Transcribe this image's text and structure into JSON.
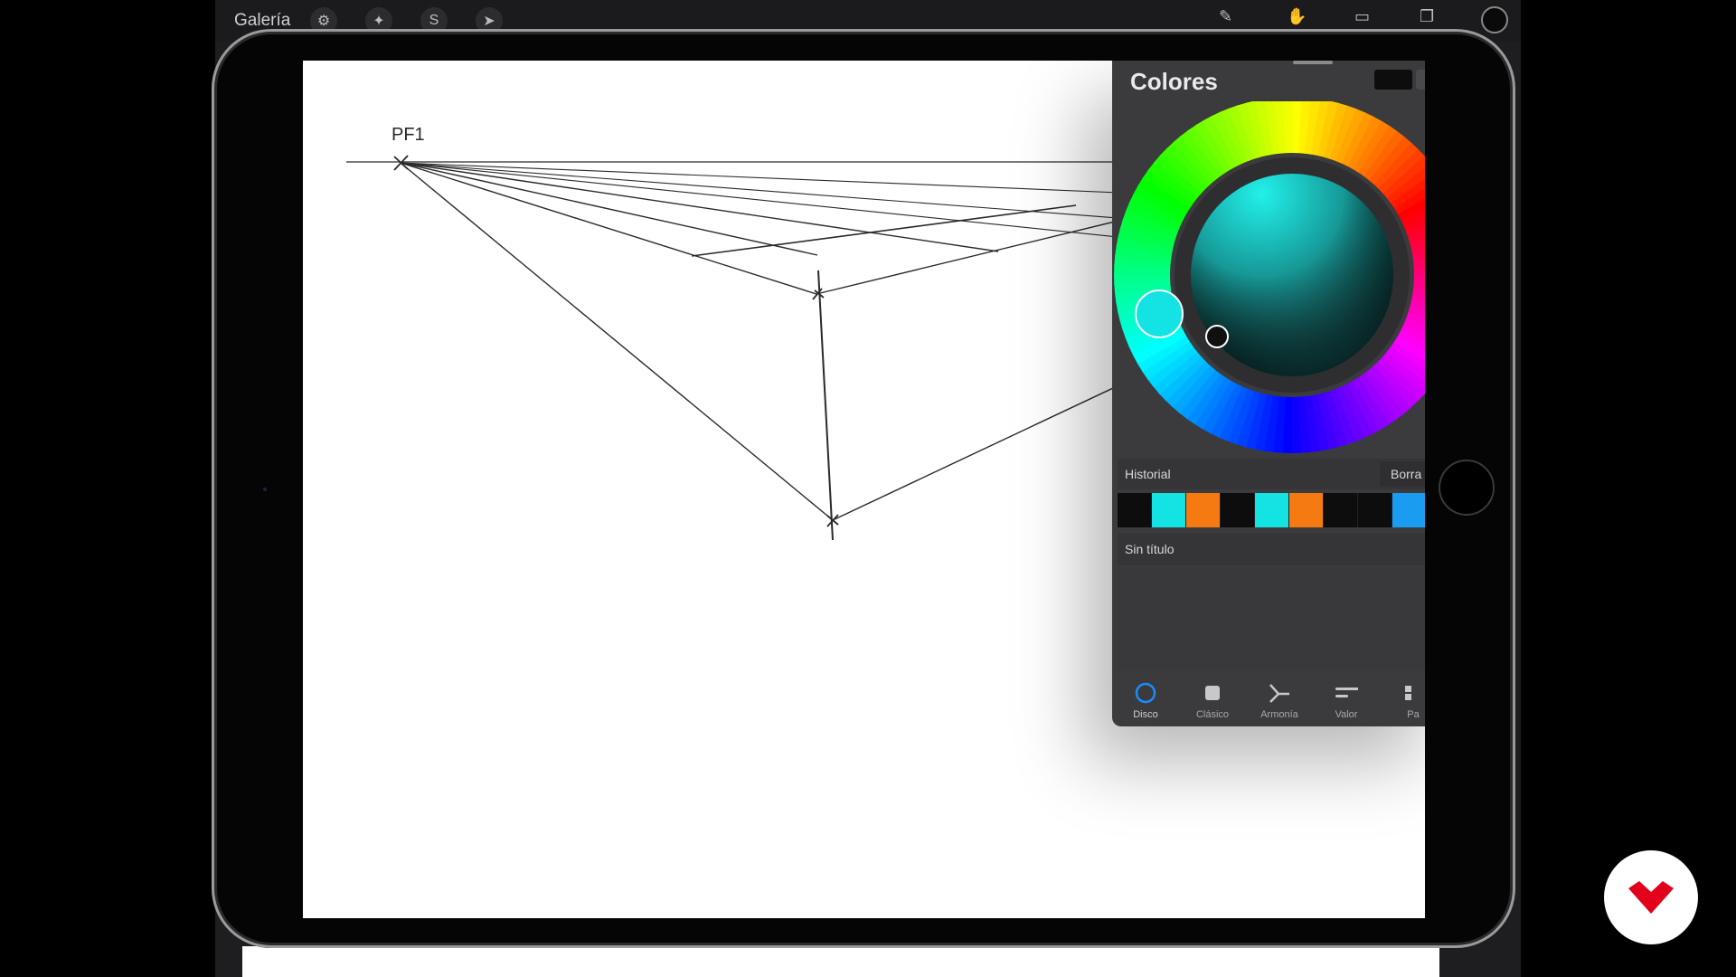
{
  "toolbar": {
    "gallery_label": "Galería",
    "left_icons": [
      "wrench-icon",
      "magic-wand-icon",
      "selection-icon",
      "transform-arrow-icon"
    ],
    "right_icons": [
      "brush-icon",
      "smudge-icon",
      "eraser-icon",
      "layers-icon"
    ]
  },
  "canvas": {
    "vanishing_point_label": "PF1"
  },
  "colors_panel": {
    "title": "Colores",
    "current_color": "#0d0d0d",
    "selected_hue_color": "#14e3e3",
    "history": {
      "label": "Historial",
      "clear_label": "Borra",
      "swatches": [
        "#0d0d0d",
        "#14e3e3",
        "#f57a12",
        "#0d0d0d",
        "#14e3e3",
        "#f57a12",
        "#0d0d0d",
        "#0d0d0d",
        "#1a9cf0"
      ]
    },
    "palette": {
      "label": "Sin título"
    },
    "tabs": [
      {
        "label": "Disco",
        "icon": "disc-icon",
        "active": true
      },
      {
        "label": "Clásico",
        "icon": "classic-square-icon",
        "active": false
      },
      {
        "label": "Armonía",
        "icon": "harmony-icon",
        "active": false
      },
      {
        "label": "Valor",
        "icon": "value-sliders-icon",
        "active": false
      },
      {
        "label": "Pa",
        "icon": "palettes-icon",
        "active": false
      }
    ]
  },
  "brand": {
    "logo_icon": "brand-logo-icon",
    "accent": "#e3001b"
  }
}
